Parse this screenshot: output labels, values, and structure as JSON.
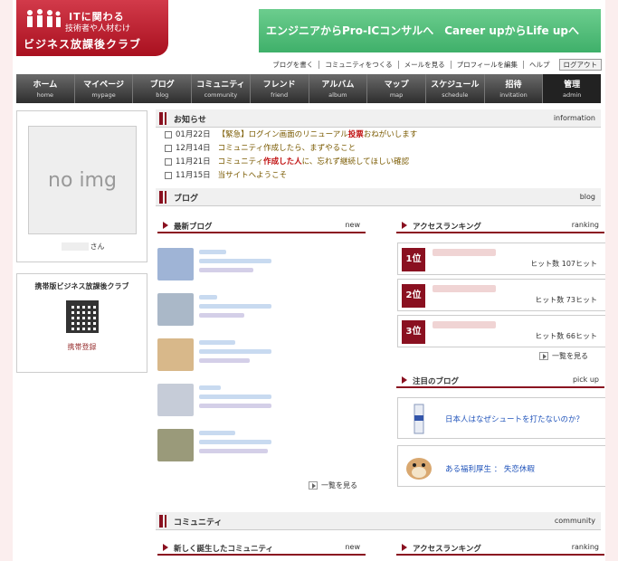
{
  "header": {
    "logo_line1": "ITに関わる",
    "logo_line2": "技術者や人材むけ",
    "logo_line3": "ビジネス放課後クラブ",
    "banner": "エンジニアからPro-ICコンサルへ　Career upからLife upへ"
  },
  "top_links": [
    "ブログを書く",
    "コミュニティをつくる",
    "メールを見る",
    "プロフィールを編集",
    "ヘルプ"
  ],
  "logout_label": "ログアウト",
  "nav": [
    {
      "ja": "ホーム",
      "en": "home"
    },
    {
      "ja": "マイページ",
      "en": "mypage"
    },
    {
      "ja": "ブログ",
      "en": "blog"
    },
    {
      "ja": "コミュニティ",
      "en": "community"
    },
    {
      "ja": "フレンド",
      "en": "friend"
    },
    {
      "ja": "アルバム",
      "en": "album"
    },
    {
      "ja": "マップ",
      "en": "map"
    },
    {
      "ja": "スケジュール",
      "en": "schedule"
    },
    {
      "ja": "招待",
      "en": "invitation"
    },
    {
      "ja": "管理",
      "en": "admin"
    }
  ],
  "profile": {
    "image_text": "no img",
    "suffix": "さん"
  },
  "mobile": {
    "title": "携帯版ビジネス放課後クラブ",
    "link": "携帯登録"
  },
  "info": {
    "title": "お知らせ",
    "en": "information",
    "items": [
      {
        "date": "01月22日",
        "pre": "【緊急】ログイン画面のリニューアル",
        "hl": "投票",
        "post": "おねがいします"
      },
      {
        "date": "12月14日",
        "pre": "コミュニティ作成したら、まずやること",
        "hl": "",
        "post": ""
      },
      {
        "date": "11月21日",
        "pre": "コミュニティ",
        "hl": "作成した人",
        "post": "に、忘れず継続してほしい確認"
      },
      {
        "date": "11月15日",
        "pre": "当サイトへようこそ",
        "hl": "",
        "post": ""
      }
    ]
  },
  "blog": {
    "title": "ブログ",
    "en": "blog",
    "latest_title": "最新ブログ",
    "latest_en": "new",
    "ranking_title": "アクセスランキング",
    "ranking_en": "ranking",
    "ranks": [
      {
        "label": "1位",
        "hits": "ヒット数  107ヒット"
      },
      {
        "label": "2位",
        "hits": "ヒット数  73ヒット"
      },
      {
        "label": "3位",
        "hits": "ヒット数  66ヒット"
      }
    ],
    "more_label": "一覧を見る",
    "pick_title": "注目のブログ",
    "pick_en": "pick up",
    "picks": [
      {
        "title": "日本人はなぜシュートを打たないのか？"
      },
      {
        "title": "ある福利厚生 ： 失恋休暇"
      }
    ]
  },
  "community": {
    "title": "コミュニティ",
    "en": "community",
    "new_title": "新しく誕生したコミュニティ",
    "new_en": "new",
    "ranking_title": "アクセスランキング",
    "ranking_en": "ranking"
  },
  "colors": {
    "brand": "#a9101f",
    "banner": "#4dbb76",
    "nav": "#3a3a3a"
  }
}
